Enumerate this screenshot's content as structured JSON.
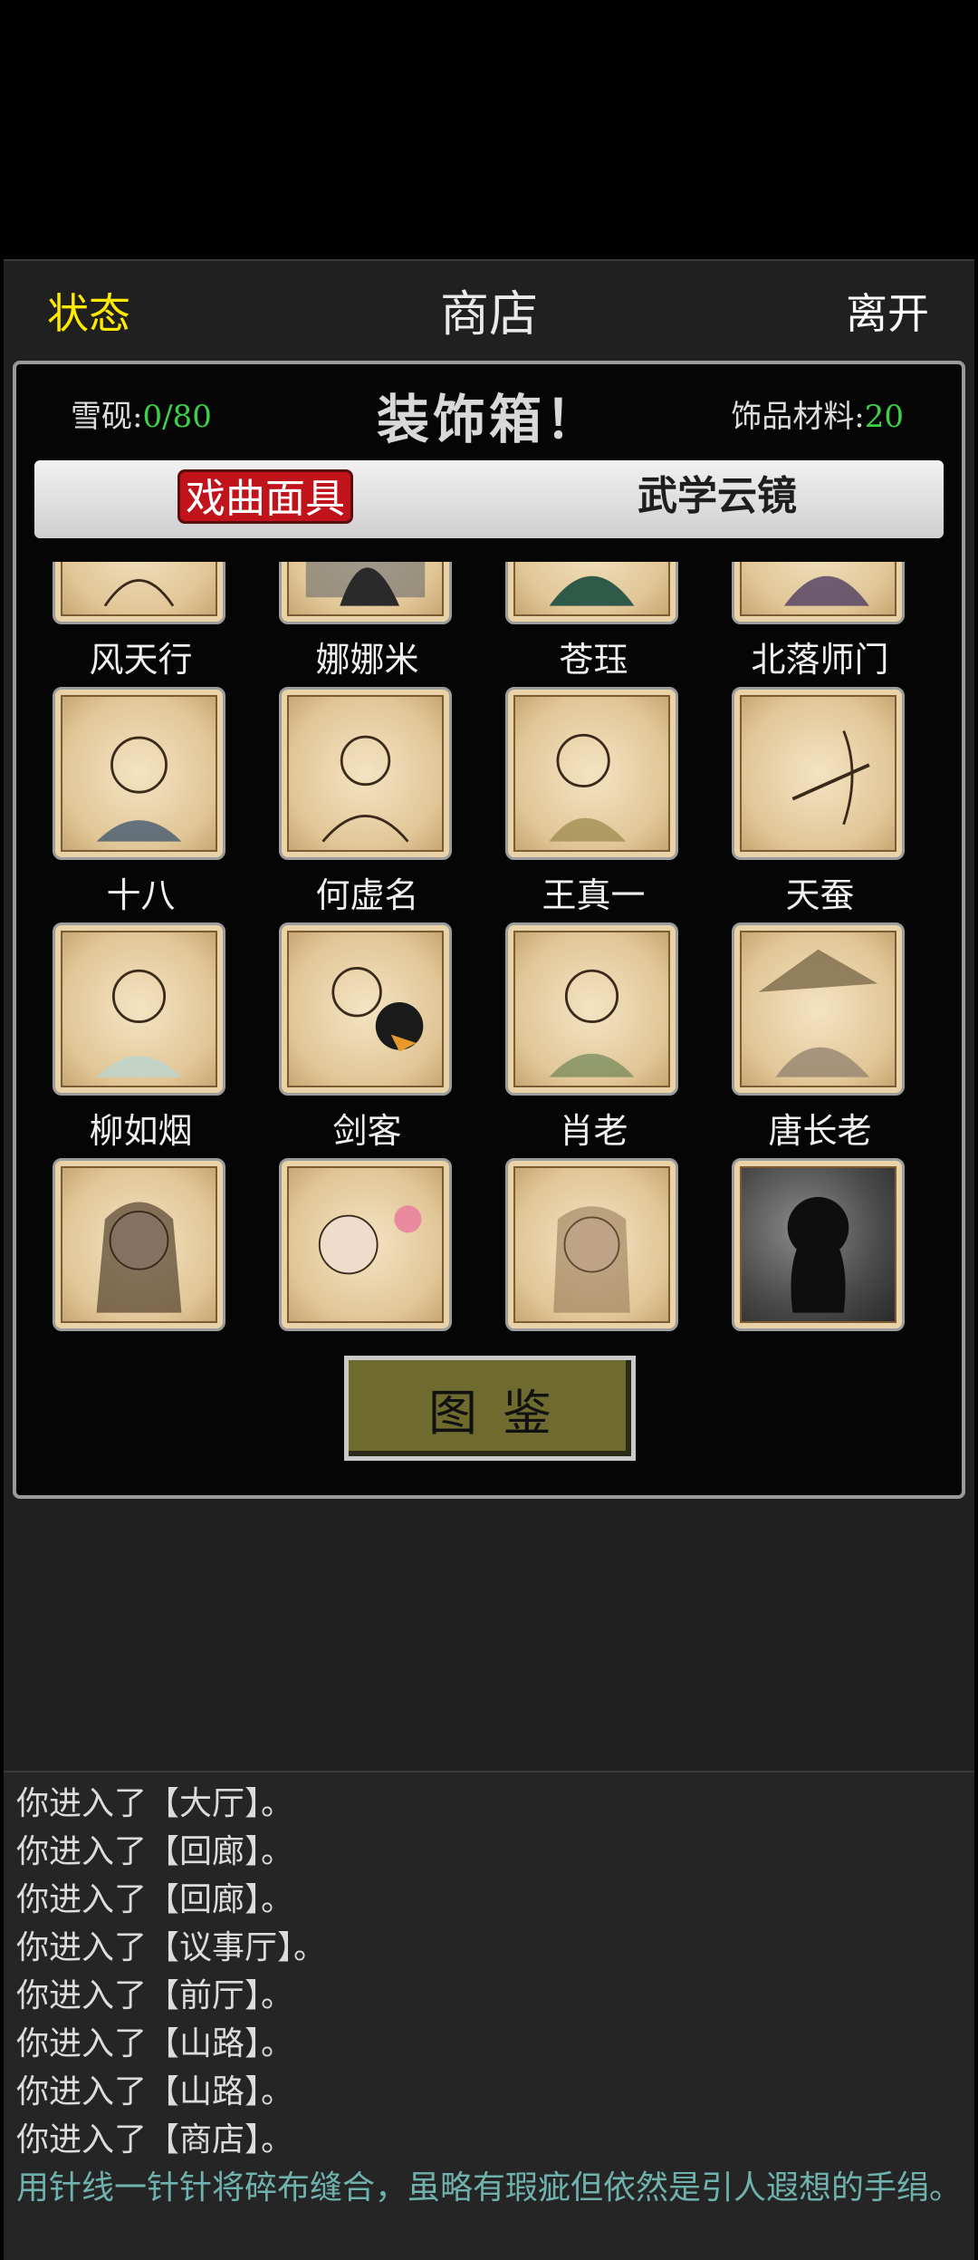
{
  "topbar": {
    "left": "状态",
    "center": "商店",
    "right": "离开"
  },
  "modal": {
    "left_label": "雪砚:",
    "left_value": "0/80",
    "title": "装饰箱！",
    "right_label": "饰品材料:",
    "right_value": "20",
    "tabs": [
      {
        "label": "戏曲面具"
      },
      {
        "label": "武学云镜"
      }
    ],
    "items": [
      {
        "name": "风天行",
        "portrait": "portrait-fengtianxing"
      },
      {
        "name": "娜娜米",
        "portrait": "portrait-nanami"
      },
      {
        "name": "苍珏",
        "portrait": "portrait-cangjue"
      },
      {
        "name": "北落师门",
        "portrait": "portrait-beiluoshimen"
      },
      {
        "name": "十八",
        "portrait": "portrait-shiba"
      },
      {
        "name": "何虚名",
        "portrait": "portrait-hexuming"
      },
      {
        "name": "王真一",
        "portrait": "portrait-wangzhenyi"
      },
      {
        "name": "天蚕",
        "portrait": "portrait-tiancan"
      },
      {
        "name": "柳如烟",
        "portrait": "portrait-liuruyan"
      },
      {
        "name": "剑客",
        "portrait": "portrait-jianke"
      },
      {
        "name": "肖老",
        "portrait": "portrait-xiaolao"
      },
      {
        "name": "唐长老",
        "portrait": "portrait-tangzhanglao"
      },
      {
        "name": "",
        "portrait": "portrait-girl"
      },
      {
        "name": "",
        "portrait": "portrait-monk"
      },
      {
        "name": "",
        "portrait": "portrait-longhair"
      },
      {
        "name": "",
        "portrait": "portrait-locked"
      }
    ],
    "button": "图鉴"
  },
  "log": {
    "lines": [
      "你进入了【大厅】。",
      "你进入了【回廊】。",
      "你进入了【回廊】。",
      "你进入了【议事厅】。",
      "你进入了【前厅】。",
      "你进入了【山路】。",
      "你进入了【山路】。",
      "你进入了【商店】。"
    ],
    "description": "用针线一针针将碎布缝合，虽略有瑕疵但依然是引人遐想的手绢。"
  },
  "colors": {
    "status": "#ffea00",
    "value_green": "#3bd24a",
    "tab_active": "#c0131b",
    "button": "#6f6b2f",
    "desc_text": "#6fb1ac"
  }
}
